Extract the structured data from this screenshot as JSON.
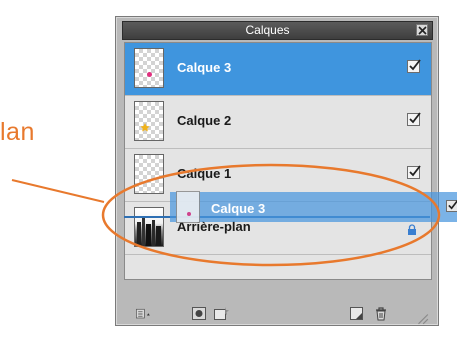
{
  "annotation": {
    "partial_text": "lan"
  },
  "panel": {
    "title": "Calques"
  },
  "layers": [
    {
      "label": "Calque 3",
      "selected": true,
      "visible": true,
      "thumb_icon": "pink-dot"
    },
    {
      "label": "Calque 2",
      "selected": false,
      "visible": true,
      "thumb_icon": "yellow-star"
    },
    {
      "label": "Calque 1",
      "selected": false,
      "visible": true,
      "thumb_icon": "blank"
    },
    {
      "label": "Arrière-plan",
      "selected": false,
      "locked": true,
      "thumb_icon": "city-photo"
    }
  ],
  "drag_ghost": {
    "label": "Calque 3"
  },
  "toolbar": {
    "items": [
      "layer-options-menu-icon",
      "add-mask-icon",
      "new-adjustment-layer-icon",
      "new-layer-icon",
      "delete-layer-icon"
    ]
  },
  "colors": {
    "selection": "#3f95de",
    "annotation": "#e8792d"
  }
}
